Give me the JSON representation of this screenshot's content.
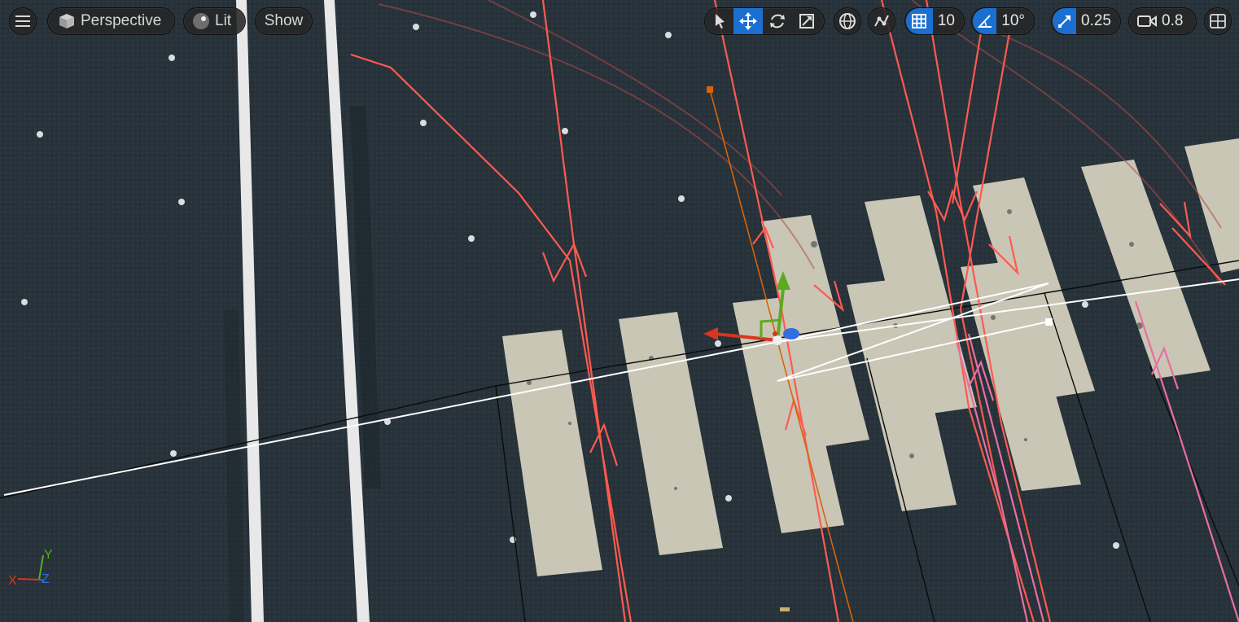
{
  "toolbar": {
    "menu_icon": "hamburger-menu-icon",
    "view_mode": "Perspective",
    "view_mode_icon": "cube-icon",
    "lighting_mode": "Lit",
    "lighting_icon": "sphere-icon",
    "show_label": "Show",
    "transform_tools": [
      "select-arrow-icon",
      "translate-move-icon",
      "rotate-icon",
      "scale-icon"
    ],
    "active_transform_tool": "translate-move-icon",
    "world_space_icon": "globe-icon",
    "surface_snap_icon": "surface-snap-icon",
    "grid_snap_value": "10",
    "rotation_snap_value": "10°",
    "scale_snap_value": "0.25",
    "camera_speed_value": "0.8",
    "layout_icon": "viewport-layout-icon"
  },
  "axis_indicator": {
    "x": "X",
    "y": "Y",
    "z": "Z"
  },
  "colors": {
    "accent": "#1a6fd0",
    "asphalt": "#263036",
    "crosswalk_paint": "#c8c6b8",
    "spline_red": "#ff5a50",
    "spline_pink": "#e86fa0",
    "gizmo_x": "#d8351c",
    "gizmo_y": "#5cab1e",
    "gizmo_z": "#2f6fe0"
  }
}
